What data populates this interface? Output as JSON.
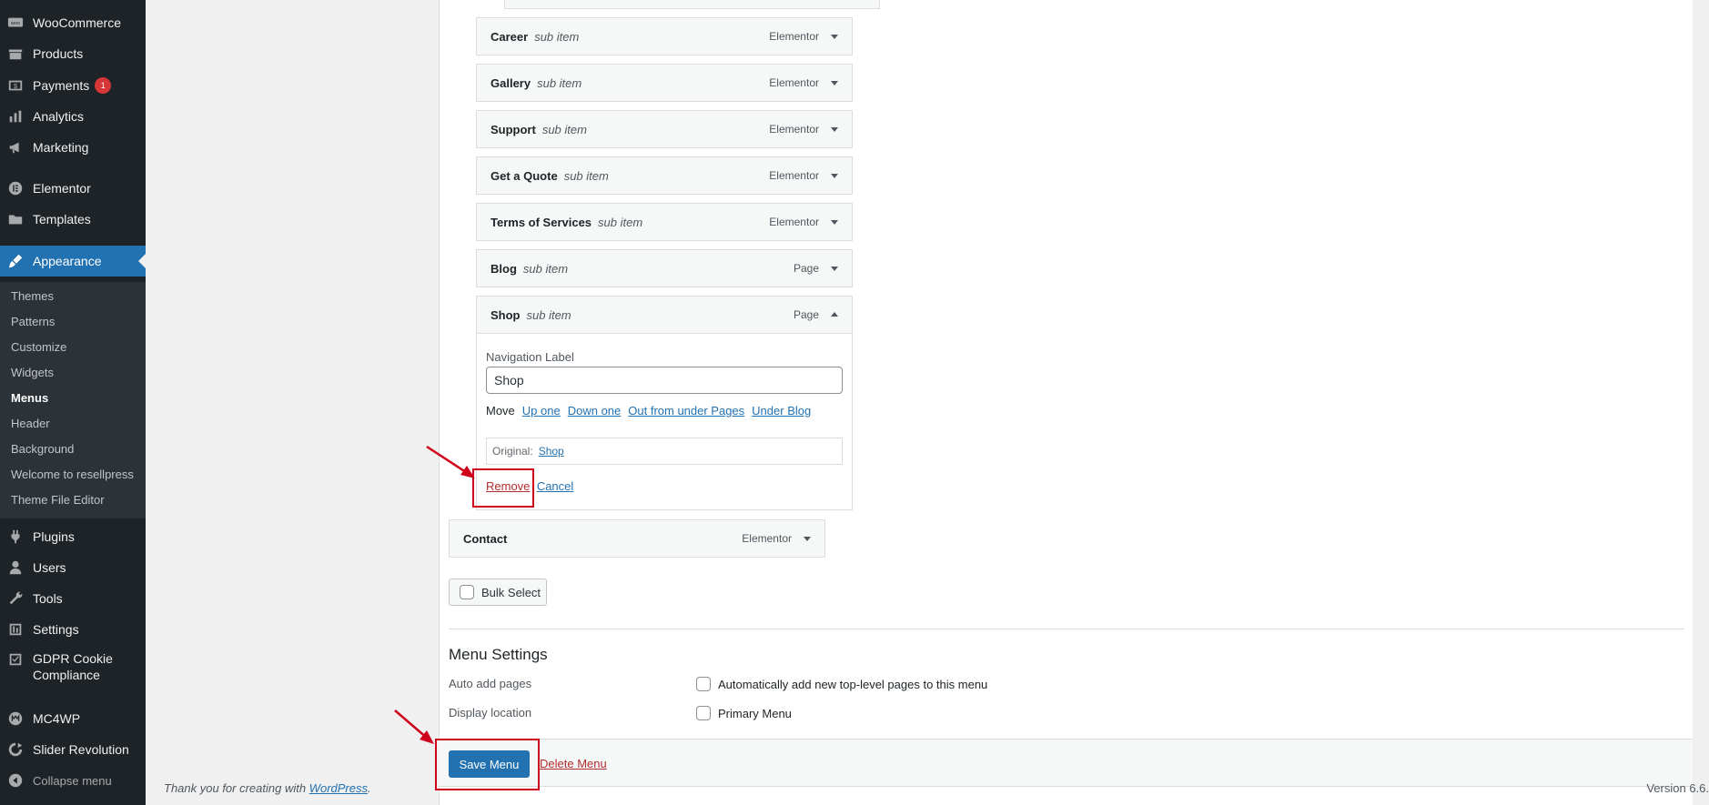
{
  "sidebar": {
    "items": [
      {
        "label": "WooCommerce",
        "icon": "woocommerce-icon"
      },
      {
        "label": "Products",
        "icon": "products-icon"
      },
      {
        "label": "Payments",
        "icon": "payments-icon",
        "badge": "1"
      },
      {
        "label": "Analytics",
        "icon": "analytics-icon"
      },
      {
        "label": "Marketing",
        "icon": "marketing-icon"
      },
      {
        "label": "Elementor",
        "icon": "elementor-icon"
      },
      {
        "label": "Templates",
        "icon": "templates-icon"
      },
      {
        "label": "Appearance",
        "icon": "appearance-icon",
        "current": true
      },
      {
        "label": "Plugins",
        "icon": "plugins-icon"
      },
      {
        "label": "Users",
        "icon": "users-icon"
      },
      {
        "label": "Tools",
        "icon": "tools-icon"
      },
      {
        "label": "Settings",
        "icon": "settings-icon"
      },
      {
        "label": "GDPR Cookie Compliance",
        "line1": "GDPR Cookie",
        "line2": "Compliance",
        "icon": "gdpr-icon"
      },
      {
        "label": "MC4WP",
        "icon": "mc4wp-icon"
      },
      {
        "label": "Slider Revolution",
        "icon": "slider-revolution-icon"
      }
    ],
    "appearance_submenu": [
      "Themes",
      "Patterns",
      "Customize",
      "Widgets",
      "Menus",
      "Header",
      "Background",
      "Welcome to resellpress",
      "Theme File Editor"
    ],
    "current_submenu": "Menus",
    "collapse_label": "Collapse menu"
  },
  "menu_items": [
    {
      "title": "Career",
      "sub": "sub item",
      "type": "Elementor"
    },
    {
      "title": "Gallery",
      "sub": "sub item",
      "type": "Elementor"
    },
    {
      "title": "Support",
      "sub": "sub item",
      "type": "Elementor"
    },
    {
      "title": "Get a Quote",
      "sub": "sub item",
      "type": "Elementor"
    },
    {
      "title": "Terms of Services",
      "sub": "sub item",
      "type": "Elementor"
    },
    {
      "title": "Blog",
      "sub": "sub item",
      "type": "Page"
    },
    {
      "title": "Shop",
      "sub": "sub item",
      "type": "Page",
      "expanded": true
    },
    {
      "title": "Contact",
      "sub": "",
      "type": "Elementor"
    }
  ],
  "item_settings": {
    "nav_label_caption": "Navigation Label",
    "nav_label_value": "Shop",
    "move_label": "Move",
    "move_links": [
      "Up one",
      "Down one",
      "Out from under Pages",
      "Under Blog"
    ],
    "original_label": "Original:",
    "original_link": "Shop",
    "remove_label": "Remove",
    "separator": "|",
    "cancel_label": "Cancel"
  },
  "bulk_select_label": "Bulk Select",
  "menu_settings": {
    "title": "Menu Settings",
    "auto_add_label": "Auto add pages",
    "auto_add_option": "Automatically add new top-level pages to this menu",
    "display_location_label": "Display location",
    "display_location_option": "Primary Menu"
  },
  "actions": {
    "save_label": "Save Menu",
    "delete_label": "Delete Menu"
  },
  "footer": {
    "thanks_text": "Thank you for creating with",
    "wordpress_link": "WordPress",
    "period": ".",
    "version": "Version 6.6."
  },
  "colors": {
    "sidebar_bg": "#1d2327",
    "submenu_bg": "#2c3338",
    "accent": "#2271b1",
    "annotation": "#d0021b",
    "badge": "#d63638"
  }
}
